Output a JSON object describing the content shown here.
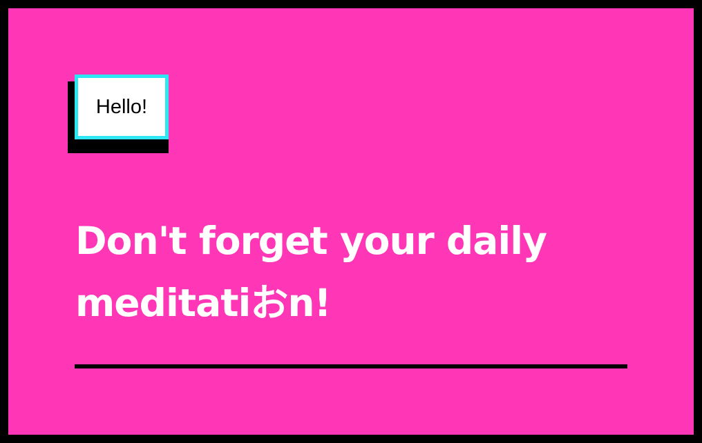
{
  "colors": {
    "background": "#ff36b6",
    "outer_frame": "#000000",
    "badge_border": "#2de7f2",
    "badge_bg": "#ffffff",
    "headline_text": "#ffffff",
    "divider": "#000000"
  },
  "badge": {
    "label": "Hello!"
  },
  "headline": {
    "text": "Don't forget your daily meditatiおn!"
  }
}
